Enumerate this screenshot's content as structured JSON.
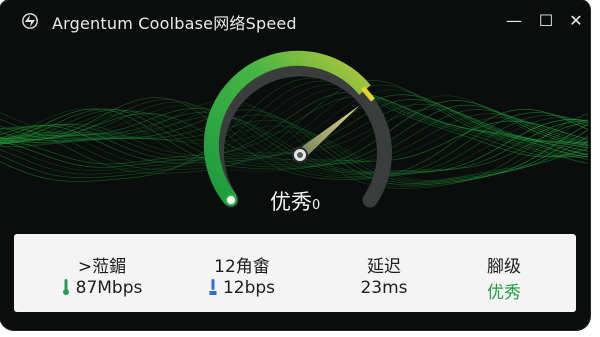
{
  "window": {
    "title": "Argentum Coolbase网络Speed",
    "controls": {
      "minimize": "—",
      "maximize": "☐",
      "close": "✕"
    }
  },
  "gauge": {
    "rating": "优秀",
    "value": "0",
    "arc_color": "#2fae45",
    "needle_color": "#d9cf7d"
  },
  "stats": [
    {
      "label": ">蒞鎇",
      "value": "87Mbps",
      "icon": "thermometer-icon"
    },
    {
      "label": "12角畬",
      "value": "12bps",
      "icon": "thermometer-icon"
    },
    {
      "label": "延迟",
      "value": "23ms"
    },
    {
      "label": "腳级",
      "value": "优秀"
    }
  ]
}
